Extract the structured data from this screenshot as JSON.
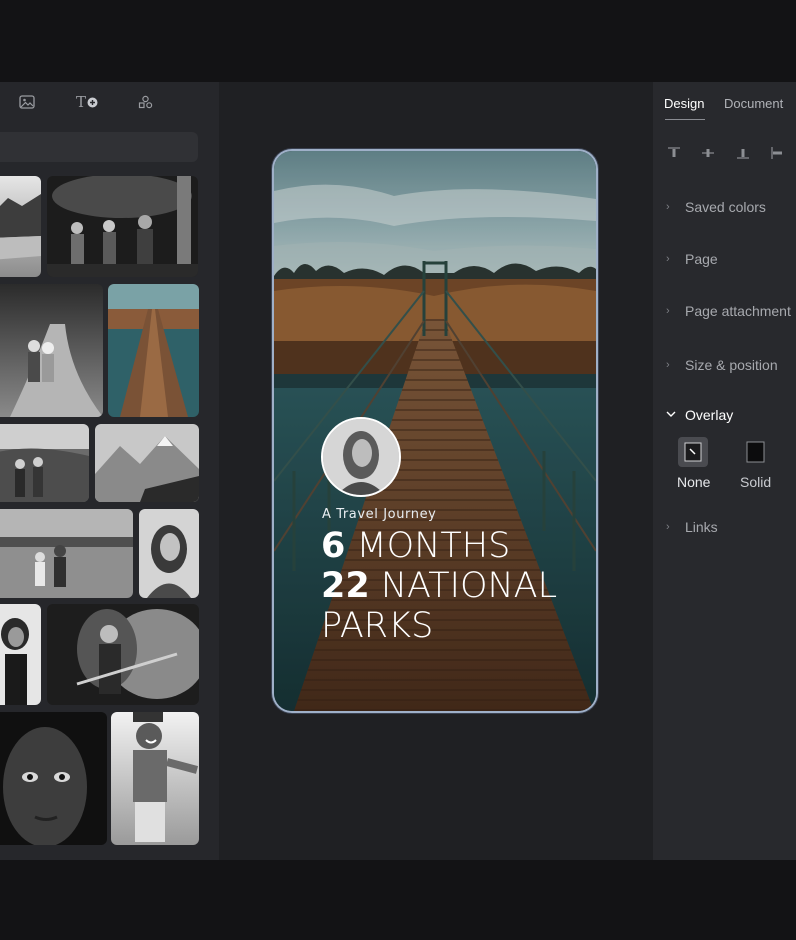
{
  "left_panel": {
    "tools": [
      {
        "name": "image-icon"
      },
      {
        "name": "text-add-icon",
        "glyph": "T"
      },
      {
        "name": "shapes-icon"
      }
    ],
    "search": {
      "placeholder": ""
    },
    "gallery_icons": [
      "rocky-landscape",
      "band-on-stage",
      "children-walking",
      "wooden-bridge",
      "hikers",
      "snowy-mountains",
      "family-field",
      "woman-portrait",
      "woman-dancing",
      "guitarist",
      "face-closeup",
      "smiling-boy"
    ]
  },
  "canvas": {
    "story": {
      "kicker": "A Travel Journey",
      "line1_num": "6",
      "line1_text": " MONTHS",
      "line2_num": "22",
      "line2_text": " NATIONAL",
      "line3_text": "PARKS"
    }
  },
  "right_panel": {
    "tabs": {
      "design": "Design",
      "document": "Document"
    },
    "sections": {
      "saved_colors": "Saved colors",
      "page": "Page",
      "page_attachment": "Page attachment",
      "size_position": "Size & position",
      "overlay": "Overlay",
      "links": "Links"
    },
    "overlay_options": {
      "none": "None",
      "solid": "Solid"
    }
  },
  "colors": {
    "app_bg": "#1f2023",
    "panel_bg": "#28292d",
    "accent_border": "#9fb0c8"
  }
}
